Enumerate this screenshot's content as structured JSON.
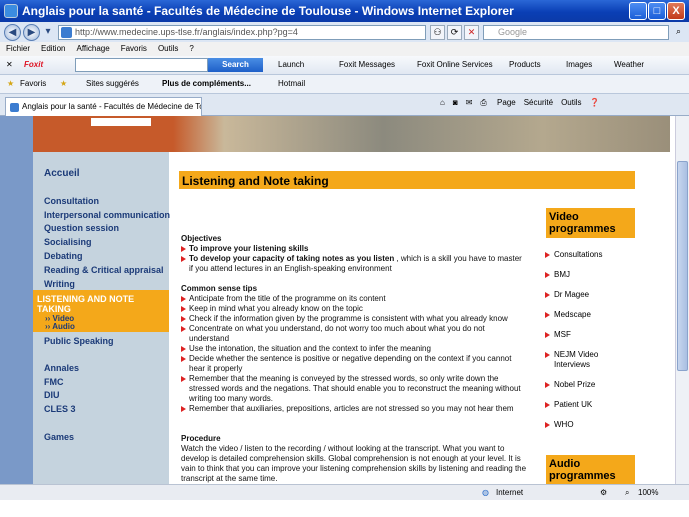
{
  "window": {
    "title": "Anglais pour la santé - Facultés de Médecine de Toulouse - Windows Internet Explorer",
    "min": "_",
    "max": "□",
    "close": "X"
  },
  "address": {
    "url": "http://www.medecine.ups-tlse.fr/anglais/index.php?pg=4",
    "search_placeholder": "Google"
  },
  "menu": [
    "Fichier",
    "Edition",
    "Affichage",
    "Favoris",
    "Outils",
    "?"
  ],
  "foxit": {
    "brand": "Foxit",
    "search": "Search",
    "items": [
      "Launch",
      "Foxit Messages",
      "Foxit Online Services",
      "Products",
      "Images",
      "Weather"
    ]
  },
  "favbar": {
    "favoris": "Favoris",
    "sites": "Sites suggérés",
    "more": "Plus de compléments...",
    "hotmail": "Hotmail"
  },
  "tab": {
    "title": "Anglais pour la santé - Facultés de Médecine de Toulo..."
  },
  "commands": [
    "Page",
    "Sécurité",
    "Outils"
  ],
  "sidebar": {
    "items": [
      "Accueil",
      "Consultation",
      "Interpersonal communication",
      "Question session",
      "Socialising",
      "Debating",
      "Reading & Critical appraisal",
      "Writing"
    ],
    "active": "LISTENING AND NOTE TAKING",
    "active_subs": [
      "›› Video",
      "›› Audio"
    ],
    "after": [
      "Public Speaking",
      "Annales",
      "FMC",
      "DIU",
      "CLES 3",
      "Games"
    ]
  },
  "main": {
    "heading": "Listening and Note taking",
    "objectives_title": "Objectives",
    "obj1": "To improve your listening skills",
    "obj2_bold": "To develop your capacity of taking notes as you listen",
    "obj2_rest": " , which is a skill you have to master if you attend lectures in an English-speaking environment",
    "tips_title": "Common sense tips",
    "tips": [
      "Anticipate from the title of the programme on its content",
      "Keep in mind what you already know on the topic",
      "Check if the information given by the programme is consistent with what you already know",
      "Concentrate on what you understand, do not worry too much about what you do not understand",
      "Use the intonation, the situation and the context to infer the meaning",
      "Decide whether the sentence is positive or negative depending on the context if you cannot hear it properly",
      "Remember that the meaning is conveyed by the stressed words, so only write down the stressed words and the negations. That should enable you to reconstruct the meaning without writing too many words.",
      "Remember that auxiliaries, prepositions, articles are not stressed so you may not hear them"
    ],
    "procedure_title": "Procedure",
    "procedure_text": "Watch the video / listen to the recording / without looking at the transcript. What you want to develop is detailed comprehension skills. Global comprehension is not enough at your level. It is vain to think that you can improve your listening comprehension skills by listening and reading the transcript at the same time."
  },
  "video": {
    "title": "Video programmes",
    "items": [
      "Consultations",
      "BMJ",
      "Dr Magee",
      "Medscape",
      "MSF",
      "NEJM Video Interviews",
      "Nobel Prize",
      "Patient UK",
      "WHO"
    ]
  },
  "audio": {
    "title": "Audio programmes"
  },
  "status": {
    "zone": "Internet",
    "zoom": "100%"
  }
}
